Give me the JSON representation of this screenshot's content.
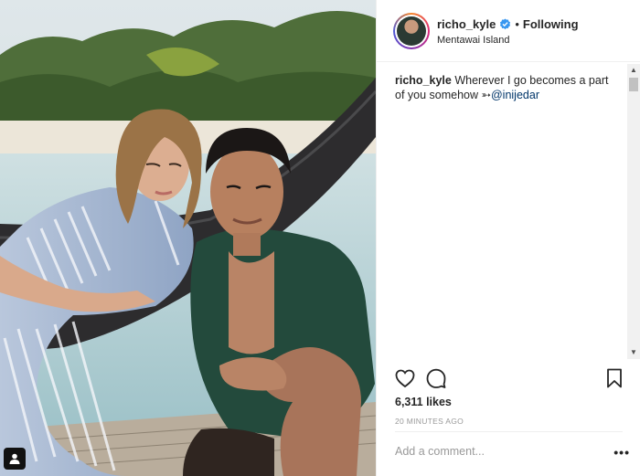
{
  "post": {
    "username": "richo_kyle",
    "follow_state": "Following",
    "separator": "•",
    "location": "Mentawai Island",
    "caption_user": "richo_kyle",
    "caption_text": " Wherever I go becomes a part of you somehow ",
    "caption_emoji": "➳",
    "caption_mention": "@inijedar",
    "likes": "6,311 likes",
    "timestamp": "20 MINUTES AGO"
  },
  "comment": {
    "placeholder": "Add a comment...",
    "more": "•••"
  },
  "icons": {
    "verified": "verified-badge-icon",
    "like": "heart-icon",
    "comment": "comment-bubble-icon",
    "save": "bookmark-icon",
    "tag": "user-tag-icon"
  },
  "colors": {
    "verified": "#3897f0",
    "mention": "#003569",
    "muted": "#999999"
  }
}
